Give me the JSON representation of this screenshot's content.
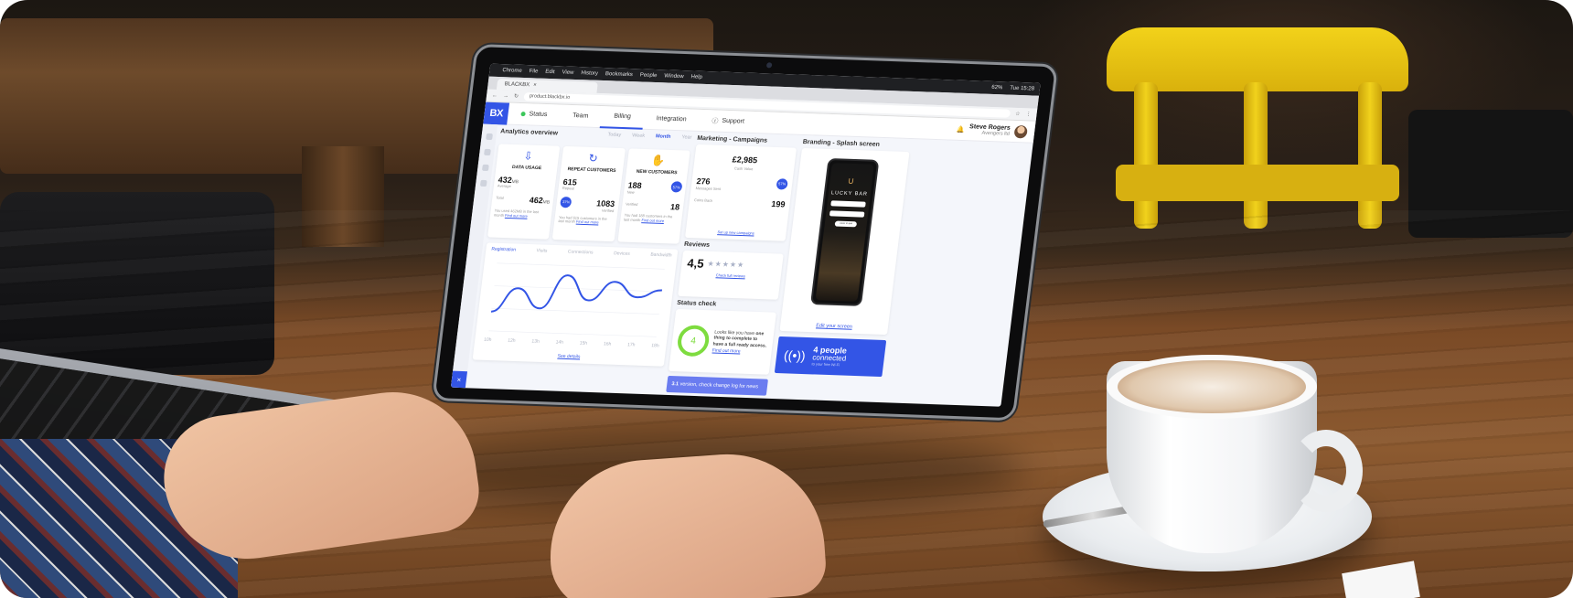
{
  "scene": {
    "description_colors": {
      "accent": "#3355e6",
      "status_green": "#7edc3f",
      "wood": "#8c5a30"
    }
  },
  "browser": {
    "menu_items": [
      "Chrome",
      "File",
      "Edit",
      "View",
      "History",
      "Bookmarks",
      "People",
      "Window",
      "Help"
    ],
    "clock": "Tue 15:28",
    "battery": "62%",
    "tab_title": "BLACKBX",
    "url": "product.blackbx.io"
  },
  "app": {
    "logo": "BX",
    "nav": [
      {
        "label": "Status"
      },
      {
        "label": "Team"
      },
      {
        "label": "Billing"
      },
      {
        "label": "Integration"
      },
      {
        "label": "Support"
      }
    ],
    "user": {
      "name": "Steve Rogers",
      "company": "Avengers ltd"
    }
  },
  "analytics": {
    "title": "Analytics overview",
    "periods": [
      "Today",
      "Week",
      "Month",
      "Year"
    ],
    "active_period": "Month",
    "cards": [
      {
        "title": "DATA USAGE",
        "value_a": "432",
        "unit_a": "MB",
        "label_a": "Average",
        "value_b": "462",
        "unit_b": "MB",
        "label_b": "Total",
        "note": "You used 462MB in the last month",
        "link": "Find out more"
      },
      {
        "title": "REPEAT CUSTOMERS",
        "value_a": "615",
        "label_a": "Repeat",
        "pct": "37%",
        "value_b": "1083",
        "label_b": "Verified",
        "note": "You had 615 customers in the last month",
        "link": "Find out more"
      },
      {
        "title": "NEW CUSTOMERS",
        "value_a": "188",
        "label_a": "New",
        "pct": "57%",
        "value_b": "18",
        "label_b": "Verified",
        "note": "You had 188 customers in the last month",
        "link": "Find out more"
      }
    ],
    "chart_tabs": [
      "Registration",
      "Visits",
      "Connections",
      "Devices",
      "Bandwidth"
    ],
    "see_details": "See details"
  },
  "chart_data": {
    "type": "line",
    "x": [
      "10h",
      "12h",
      "13h",
      "14h",
      "15h",
      "16h",
      "17h",
      "18h"
    ],
    "series": [
      {
        "values": [
          20,
          45,
          25,
          60,
          35,
          55,
          40,
          48
        ]
      }
    ]
  },
  "marketing": {
    "title": "Marketing - Campaigns",
    "cash": "£2,985",
    "cash_label": "Cash Value",
    "messages": "276",
    "messages_label": "Messages Sent",
    "pct": "57%",
    "coins": "199",
    "coins_label": "Coins Back",
    "link": "Set up new campaigns"
  },
  "reviews": {
    "title": "Reviews",
    "score": "4,5",
    "stars": "★★★★★",
    "link": "Check full reviews"
  },
  "status": {
    "title": "Status check",
    "count": "4",
    "text_a": "Looks like you have",
    "text_b": "one thing to complete to have a",
    "text_c": "full ready access.",
    "link": "Find out more",
    "version": "3.1",
    "version_text": "version, check change log for news"
  },
  "branding": {
    "title": "Branding - Splash screen",
    "phone_logo": "∪",
    "phone_name": "LUCKY BAR",
    "phone_button": "LOGIN TO BAR",
    "link": "Edit your screen"
  },
  "people": {
    "count_line": "4 people",
    "status_line": "connected",
    "sub": "to your free Wi-Fi"
  }
}
